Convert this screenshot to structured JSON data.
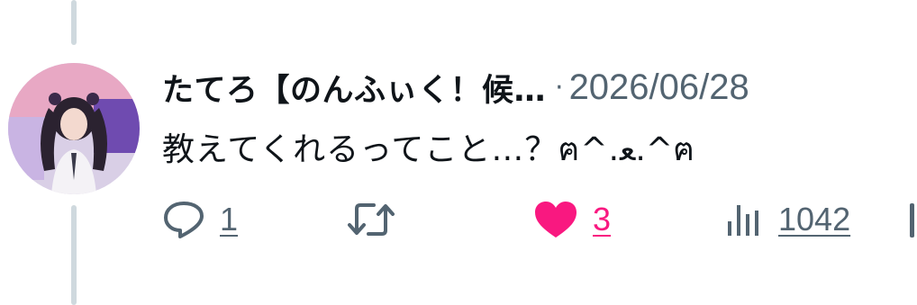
{
  "tweet": {
    "display_name": "たてろ【のんふぃく！候…",
    "separator": "·",
    "timestamp": "2026/06/28",
    "text": "教えてくれるってこと…？ฅ^.ﻌ.^ฅ"
  },
  "actions": {
    "reply_count": "1",
    "retweet_count": "",
    "like_count": "3",
    "view_count": "1042",
    "icons": {
      "reply": "reply-icon",
      "retweet": "retweet-icon",
      "like": "heart-filled-icon",
      "views": "views-icon",
      "share": "share-icon"
    }
  },
  "colors": {
    "text": "#0f1419",
    "secondary": "#536471",
    "like": "#f91880",
    "thread_line": "#cfd9de"
  }
}
